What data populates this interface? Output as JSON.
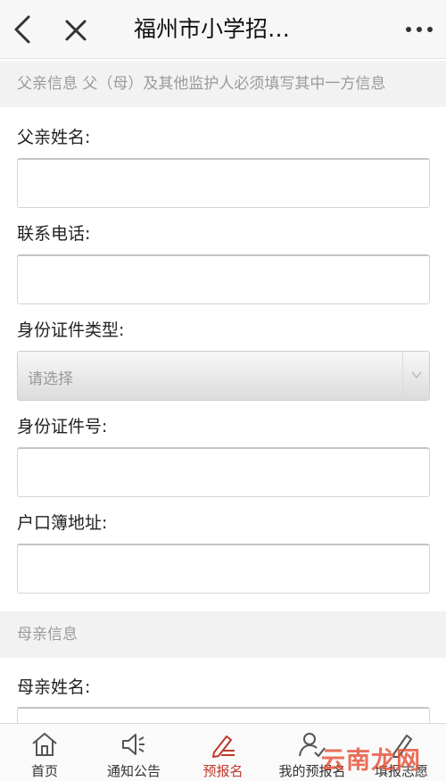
{
  "header": {
    "title": "福州市小学招…"
  },
  "father": {
    "section_title": "父亲信息 父（母）及其他监护人必须填写其中一方信息",
    "name_label": "父亲姓名:",
    "phone_label": "联系电话:",
    "id_type_label": "身份证件类型:",
    "id_type_value": "请选择",
    "id_number_label": "身份证件号:",
    "household_label": "户口簿地址:"
  },
  "mother": {
    "section_title": "母亲信息",
    "name_label": "母亲姓名:"
  },
  "tabs": [
    {
      "label": "首页",
      "icon": "home-icon"
    },
    {
      "label": "通知公告",
      "icon": "megaphone-icon"
    },
    {
      "label": "预报名",
      "icon": "edit-icon",
      "active": true
    },
    {
      "label": "我的预报名",
      "icon": "user-check-icon"
    },
    {
      "label": "填报志愿",
      "icon": "pencil-icon"
    }
  ],
  "watermark": "云南龙网",
  "colors": {
    "accent": "#c0392b",
    "watermark": "#e8563f"
  }
}
